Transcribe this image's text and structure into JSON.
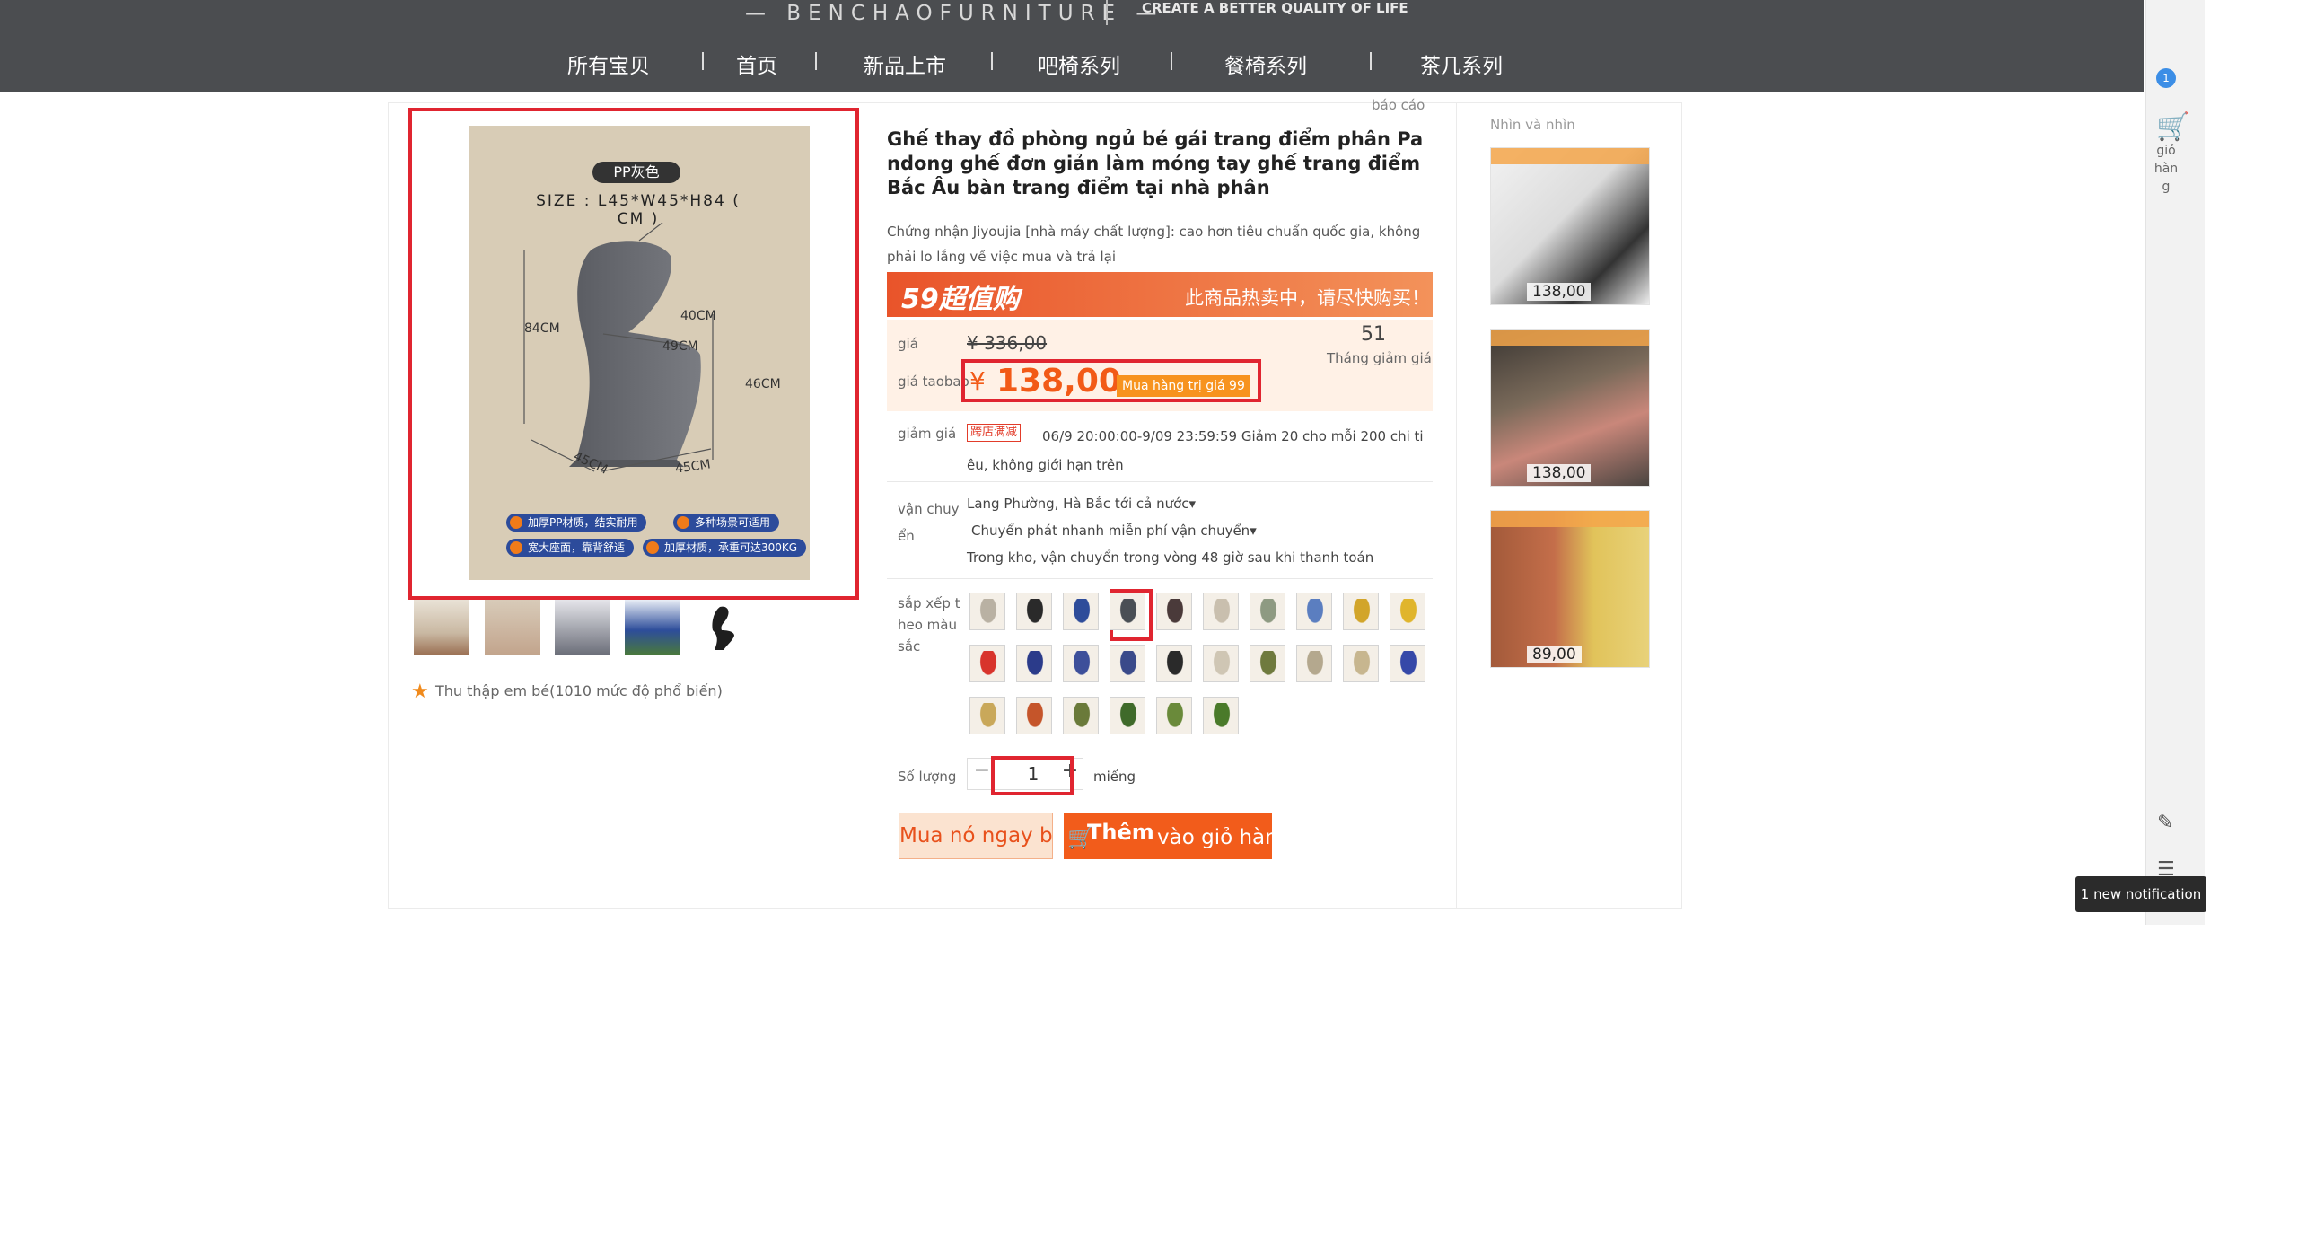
{
  "header": {
    "brand": "— BENCHAOFURNITURE —",
    "tagline": "CREATE A BETTER QUALITY OF LIFE",
    "nav": [
      "所有宝贝",
      "首页",
      "新品上市",
      "吧椅系列",
      "餐椅系列",
      "茶几系列"
    ]
  },
  "gallery": {
    "badge": "PP灰色",
    "size_text": "SIZE : L45*W45*H84 ( CM )",
    "dims": {
      "height": "84CM",
      "back": "40CM",
      "seat": "49CM",
      "seat_height": "46CM",
      "depth": "45CM",
      "width": "45CM"
    },
    "features": [
      "加厚PP材质，结实耐用",
      "多种场景可适用",
      "宽大座面，靠背舒适",
      "加厚材质，承重可达300KG"
    ],
    "favorite_text": "Thu thập em bé(1010 mức độ phổ biến)"
  },
  "product": {
    "report": "báo cáo",
    "title": "Ghế thay đồ phòng ngủ bé gái trang điểm phân Pandong ghế đơn giản làm móng tay ghế trang điểm Bắc Âu bàn trang điểm tại nhà phân",
    "subtitle": "Chứng nhận Jiyoujia [nhà máy chất lượng]: cao hơn tiêu chuẩn quốc gia, không phải lo lắng về việc mua và trả lại",
    "promo_logo": "59超值购",
    "promo_text": "此商品热卖中，请尽快购买！",
    "price_label": "giá",
    "original_price": "¥ 336,00",
    "sold_count": "51",
    "sold_label": "Tháng giảm giá",
    "taobao_label": "giá taobao",
    "yen": "¥",
    "current_price": "138,00",
    "price_badge": "Mua hàng trị giá 99",
    "discount_label": "giảm giá",
    "discount_tag": "跨店满减",
    "discount_text": "06/9 20:00:00-9/09 23:59:59 Giảm 20 cho mỗi 200 chi tiêu, không giới hạn trên",
    "ship_label": "vận chuyển",
    "ship_from": "Lang Phường, Hà Bắc tới cả nước▾",
    "ship_method": "Chuyển phát nhanh miễn phí vận chuyển▾",
    "ship_stock": "Trong kho, vận chuyển trong vòng 48 giờ sau khi thanh toán",
    "color_label": "sắp xếp theo màu sắc",
    "qty_label": "Số lượng",
    "qty_minus": "−",
    "qty_value": "1",
    "qty_plus": "+",
    "qty_unit": "miếng",
    "buy_now": "Mua nó ngay bây giờ",
    "add_cart_1": "Thêm",
    "add_cart_2": "vào giỏ hàng"
  },
  "swatch_colors": [
    "#b9b1a3",
    "#2a2a2a",
    "#2e4c9a",
    "#4a4f55",
    "#4a3a3a",
    "#c9bfae",
    "#8e9a82",
    "#5b7ec0",
    "#d2a52a",
    "#e0b52c",
    "#d8342c",
    "#2b3b8a",
    "#3d4f9a",
    "#3a4a8a",
    "#2a2a2a",
    "#cfc6b4",
    "#6f7a3e",
    "#b4a88e",
    "#c7b68f",
    "#3548a8",
    "#c9a85a",
    "#c5552a",
    "#6a7a3a",
    "#3f6a2a",
    "#6a8a3a",
    "#4a7a2a"
  ],
  "side": {
    "title": "Nhìn và nhìn",
    "prices": [
      "138,00",
      "138,00",
      "89,00"
    ]
  },
  "rail": {
    "badge": "1",
    "cart_label": "giỏ hàng"
  },
  "tooltip": "1 new notification"
}
